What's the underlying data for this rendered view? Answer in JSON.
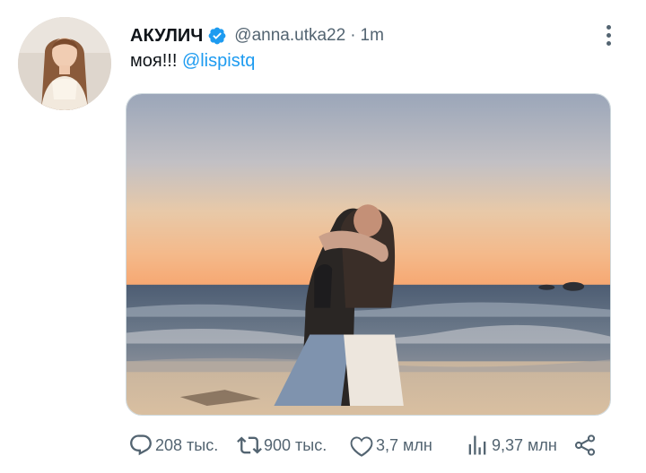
{
  "author": {
    "name": "АКУЛИЧ",
    "handle": "@anna.utka22",
    "separator": "·",
    "time": "1m",
    "verified": true
  },
  "tweet": {
    "text_prefix": "моя!!! ",
    "mention": "@lispistq"
  },
  "media": {
    "description_icon": "photo"
  },
  "actions": {
    "replies": "208 тыс.",
    "retweets": "900 тыс.",
    "likes": "3,7 млн",
    "views": "9,37 млн"
  },
  "colors": {
    "accent": "#1d9bf0",
    "text_primary": "#0f1419",
    "text_secondary": "#536471"
  }
}
